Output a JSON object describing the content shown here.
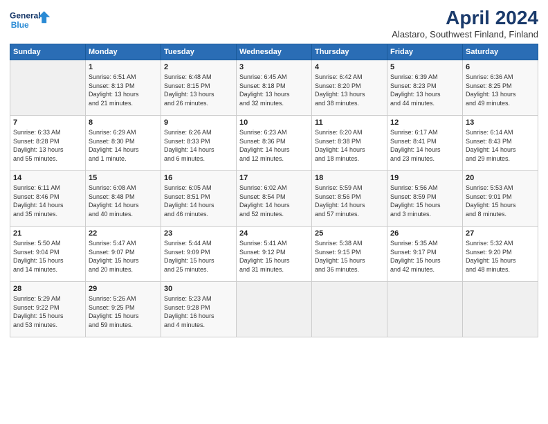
{
  "logo": {
    "line1": "General",
    "line2": "Blue"
  },
  "title": "April 2024",
  "subtitle": "Alastaro, Southwest Finland, Finland",
  "days_header": [
    "Sunday",
    "Monday",
    "Tuesday",
    "Wednesday",
    "Thursday",
    "Friday",
    "Saturday"
  ],
  "weeks": [
    [
      {
        "num": "",
        "info": ""
      },
      {
        "num": "1",
        "info": "Sunrise: 6:51 AM\nSunset: 8:13 PM\nDaylight: 13 hours\nand 21 minutes."
      },
      {
        "num": "2",
        "info": "Sunrise: 6:48 AM\nSunset: 8:15 PM\nDaylight: 13 hours\nand 26 minutes."
      },
      {
        "num": "3",
        "info": "Sunrise: 6:45 AM\nSunset: 8:18 PM\nDaylight: 13 hours\nand 32 minutes."
      },
      {
        "num": "4",
        "info": "Sunrise: 6:42 AM\nSunset: 8:20 PM\nDaylight: 13 hours\nand 38 minutes."
      },
      {
        "num": "5",
        "info": "Sunrise: 6:39 AM\nSunset: 8:23 PM\nDaylight: 13 hours\nand 44 minutes."
      },
      {
        "num": "6",
        "info": "Sunrise: 6:36 AM\nSunset: 8:25 PM\nDaylight: 13 hours\nand 49 minutes."
      }
    ],
    [
      {
        "num": "7",
        "info": "Sunrise: 6:33 AM\nSunset: 8:28 PM\nDaylight: 13 hours\nand 55 minutes."
      },
      {
        "num": "8",
        "info": "Sunrise: 6:29 AM\nSunset: 8:30 PM\nDaylight: 14 hours\nand 1 minute."
      },
      {
        "num": "9",
        "info": "Sunrise: 6:26 AM\nSunset: 8:33 PM\nDaylight: 14 hours\nand 6 minutes."
      },
      {
        "num": "10",
        "info": "Sunrise: 6:23 AM\nSunset: 8:36 PM\nDaylight: 14 hours\nand 12 minutes."
      },
      {
        "num": "11",
        "info": "Sunrise: 6:20 AM\nSunset: 8:38 PM\nDaylight: 14 hours\nand 18 minutes."
      },
      {
        "num": "12",
        "info": "Sunrise: 6:17 AM\nSunset: 8:41 PM\nDaylight: 14 hours\nand 23 minutes."
      },
      {
        "num": "13",
        "info": "Sunrise: 6:14 AM\nSunset: 8:43 PM\nDaylight: 14 hours\nand 29 minutes."
      }
    ],
    [
      {
        "num": "14",
        "info": "Sunrise: 6:11 AM\nSunset: 8:46 PM\nDaylight: 14 hours\nand 35 minutes."
      },
      {
        "num": "15",
        "info": "Sunrise: 6:08 AM\nSunset: 8:48 PM\nDaylight: 14 hours\nand 40 minutes."
      },
      {
        "num": "16",
        "info": "Sunrise: 6:05 AM\nSunset: 8:51 PM\nDaylight: 14 hours\nand 46 minutes."
      },
      {
        "num": "17",
        "info": "Sunrise: 6:02 AM\nSunset: 8:54 PM\nDaylight: 14 hours\nand 52 minutes."
      },
      {
        "num": "18",
        "info": "Sunrise: 5:59 AM\nSunset: 8:56 PM\nDaylight: 14 hours\nand 57 minutes."
      },
      {
        "num": "19",
        "info": "Sunrise: 5:56 AM\nSunset: 8:59 PM\nDaylight: 15 hours\nand 3 minutes."
      },
      {
        "num": "20",
        "info": "Sunrise: 5:53 AM\nSunset: 9:01 PM\nDaylight: 15 hours\nand 8 minutes."
      }
    ],
    [
      {
        "num": "21",
        "info": "Sunrise: 5:50 AM\nSunset: 9:04 PM\nDaylight: 15 hours\nand 14 minutes."
      },
      {
        "num": "22",
        "info": "Sunrise: 5:47 AM\nSunset: 9:07 PM\nDaylight: 15 hours\nand 20 minutes."
      },
      {
        "num": "23",
        "info": "Sunrise: 5:44 AM\nSunset: 9:09 PM\nDaylight: 15 hours\nand 25 minutes."
      },
      {
        "num": "24",
        "info": "Sunrise: 5:41 AM\nSunset: 9:12 PM\nDaylight: 15 hours\nand 31 minutes."
      },
      {
        "num": "25",
        "info": "Sunrise: 5:38 AM\nSunset: 9:15 PM\nDaylight: 15 hours\nand 36 minutes."
      },
      {
        "num": "26",
        "info": "Sunrise: 5:35 AM\nSunset: 9:17 PM\nDaylight: 15 hours\nand 42 minutes."
      },
      {
        "num": "27",
        "info": "Sunrise: 5:32 AM\nSunset: 9:20 PM\nDaylight: 15 hours\nand 48 minutes."
      }
    ],
    [
      {
        "num": "28",
        "info": "Sunrise: 5:29 AM\nSunset: 9:22 PM\nDaylight: 15 hours\nand 53 minutes."
      },
      {
        "num": "29",
        "info": "Sunrise: 5:26 AM\nSunset: 9:25 PM\nDaylight: 15 hours\nand 59 minutes."
      },
      {
        "num": "30",
        "info": "Sunrise: 5:23 AM\nSunset: 9:28 PM\nDaylight: 16 hours\nand 4 minutes."
      },
      {
        "num": "",
        "info": ""
      },
      {
        "num": "",
        "info": ""
      },
      {
        "num": "",
        "info": ""
      },
      {
        "num": "",
        "info": ""
      }
    ]
  ]
}
